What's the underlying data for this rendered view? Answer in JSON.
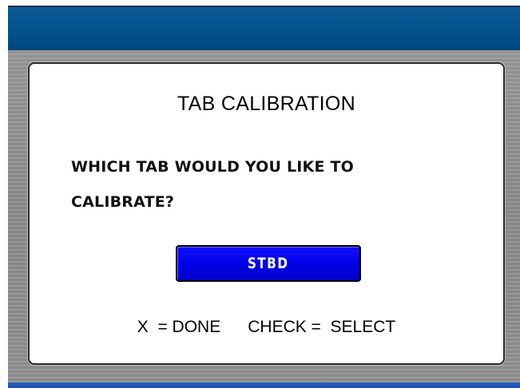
{
  "dialog": {
    "title": "TAB CALIBRATION",
    "prompt_line1": "WHICH TAB WOULD YOU LIKE TO",
    "prompt_line2": "CALIBRATE?",
    "selection_button": "STBD",
    "hint_done": "X  = DONE",
    "hint_select": "CHECK =  SELECT"
  },
  "colors": {
    "title_bar": "#004f8a",
    "selection_button": "#0000e6",
    "bezel": "#8f8f8f",
    "bottom_bar": "#1c4fae"
  }
}
